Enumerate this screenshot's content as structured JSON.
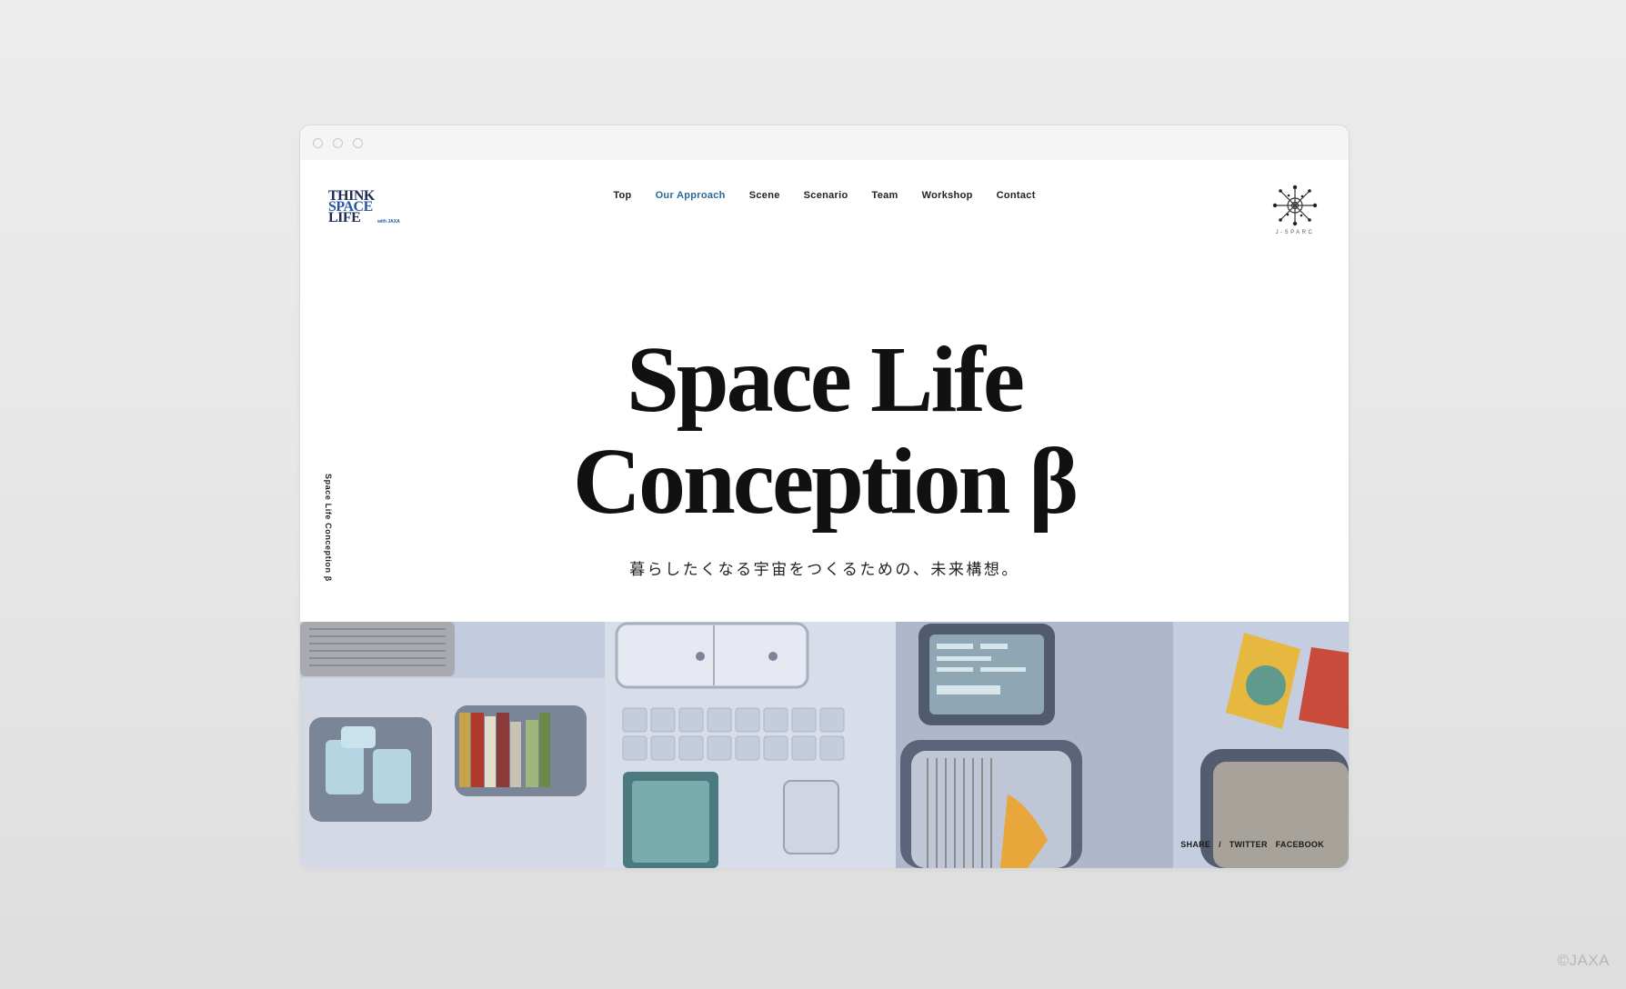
{
  "browser": {
    "window_dots": [
      "",
      "",
      ""
    ]
  },
  "logo": {
    "lines": [
      "THINK",
      "SPACE",
      "LIFE"
    ],
    "sub": "with JAXA"
  },
  "nav": {
    "items": [
      "Top",
      "Our Approach",
      "Scene",
      "Scenario",
      "Team",
      "Workshop",
      "Contact"
    ],
    "active": "Our Approach"
  },
  "partner_logo": {
    "label": "J-SPARC",
    "icon": "j-sparc-emblem-icon"
  },
  "sidebar": {
    "vertical_title": "Space Life Conception β"
  },
  "hero": {
    "title_line1": "Space Life",
    "title_line2": "Conception β",
    "subtitle": "暮らしたくなる宇宙をつくるための、未来構想。"
  },
  "share": {
    "label": "SHARE",
    "separator": "/",
    "twitter": "TWITTER",
    "facebook": "FACEBOOK"
  },
  "credit": "©JAXA",
  "colors": {
    "accent_nav": "#2a6a9a",
    "logo_navy": "#1d2b55",
    "logo_blue": "#2556a6",
    "scene_base": "#c3ccdf"
  }
}
